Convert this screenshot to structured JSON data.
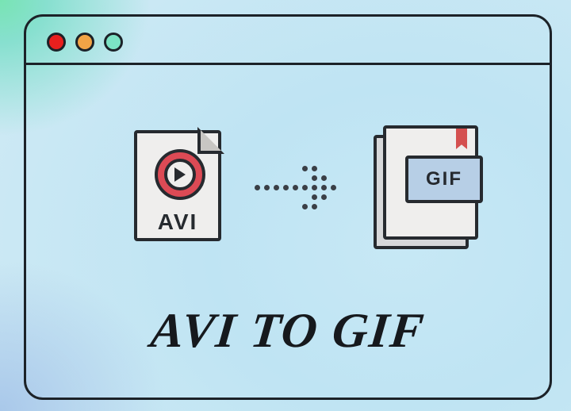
{
  "source_format_label": "AVI",
  "target_format_label": "GIF",
  "headline": "AVI TO GIF",
  "colors": {
    "close": "#e8201e",
    "minimize": "#f3a446",
    "zoom": "#7ce3c4",
    "gif_badge_bg": "#b7cfe6",
    "avi_play_bg": "#dc4a55",
    "bookmark": "#d45050"
  }
}
